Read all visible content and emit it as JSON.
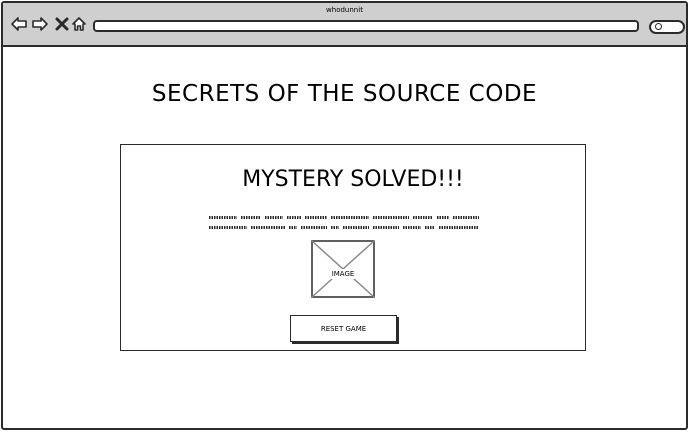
{
  "window": {
    "title": "whodunnit"
  },
  "toolbar": {
    "icons": [
      "back-arrow-icon",
      "forward-arrow-icon",
      "close-icon",
      "home-icon"
    ],
    "url_value": "",
    "search_value": ""
  },
  "page": {
    "title": "SECRETS OF THE SOURCE CODE"
  },
  "result_card": {
    "title": "MYSTERY SOLVED!!!",
    "image_label": "IMAGE",
    "reset_label": "RESET GAME"
  },
  "colors": {
    "chrome": "#cfcfcf",
    "stroke": "#2b2b2b",
    "background": "#ffffff"
  }
}
